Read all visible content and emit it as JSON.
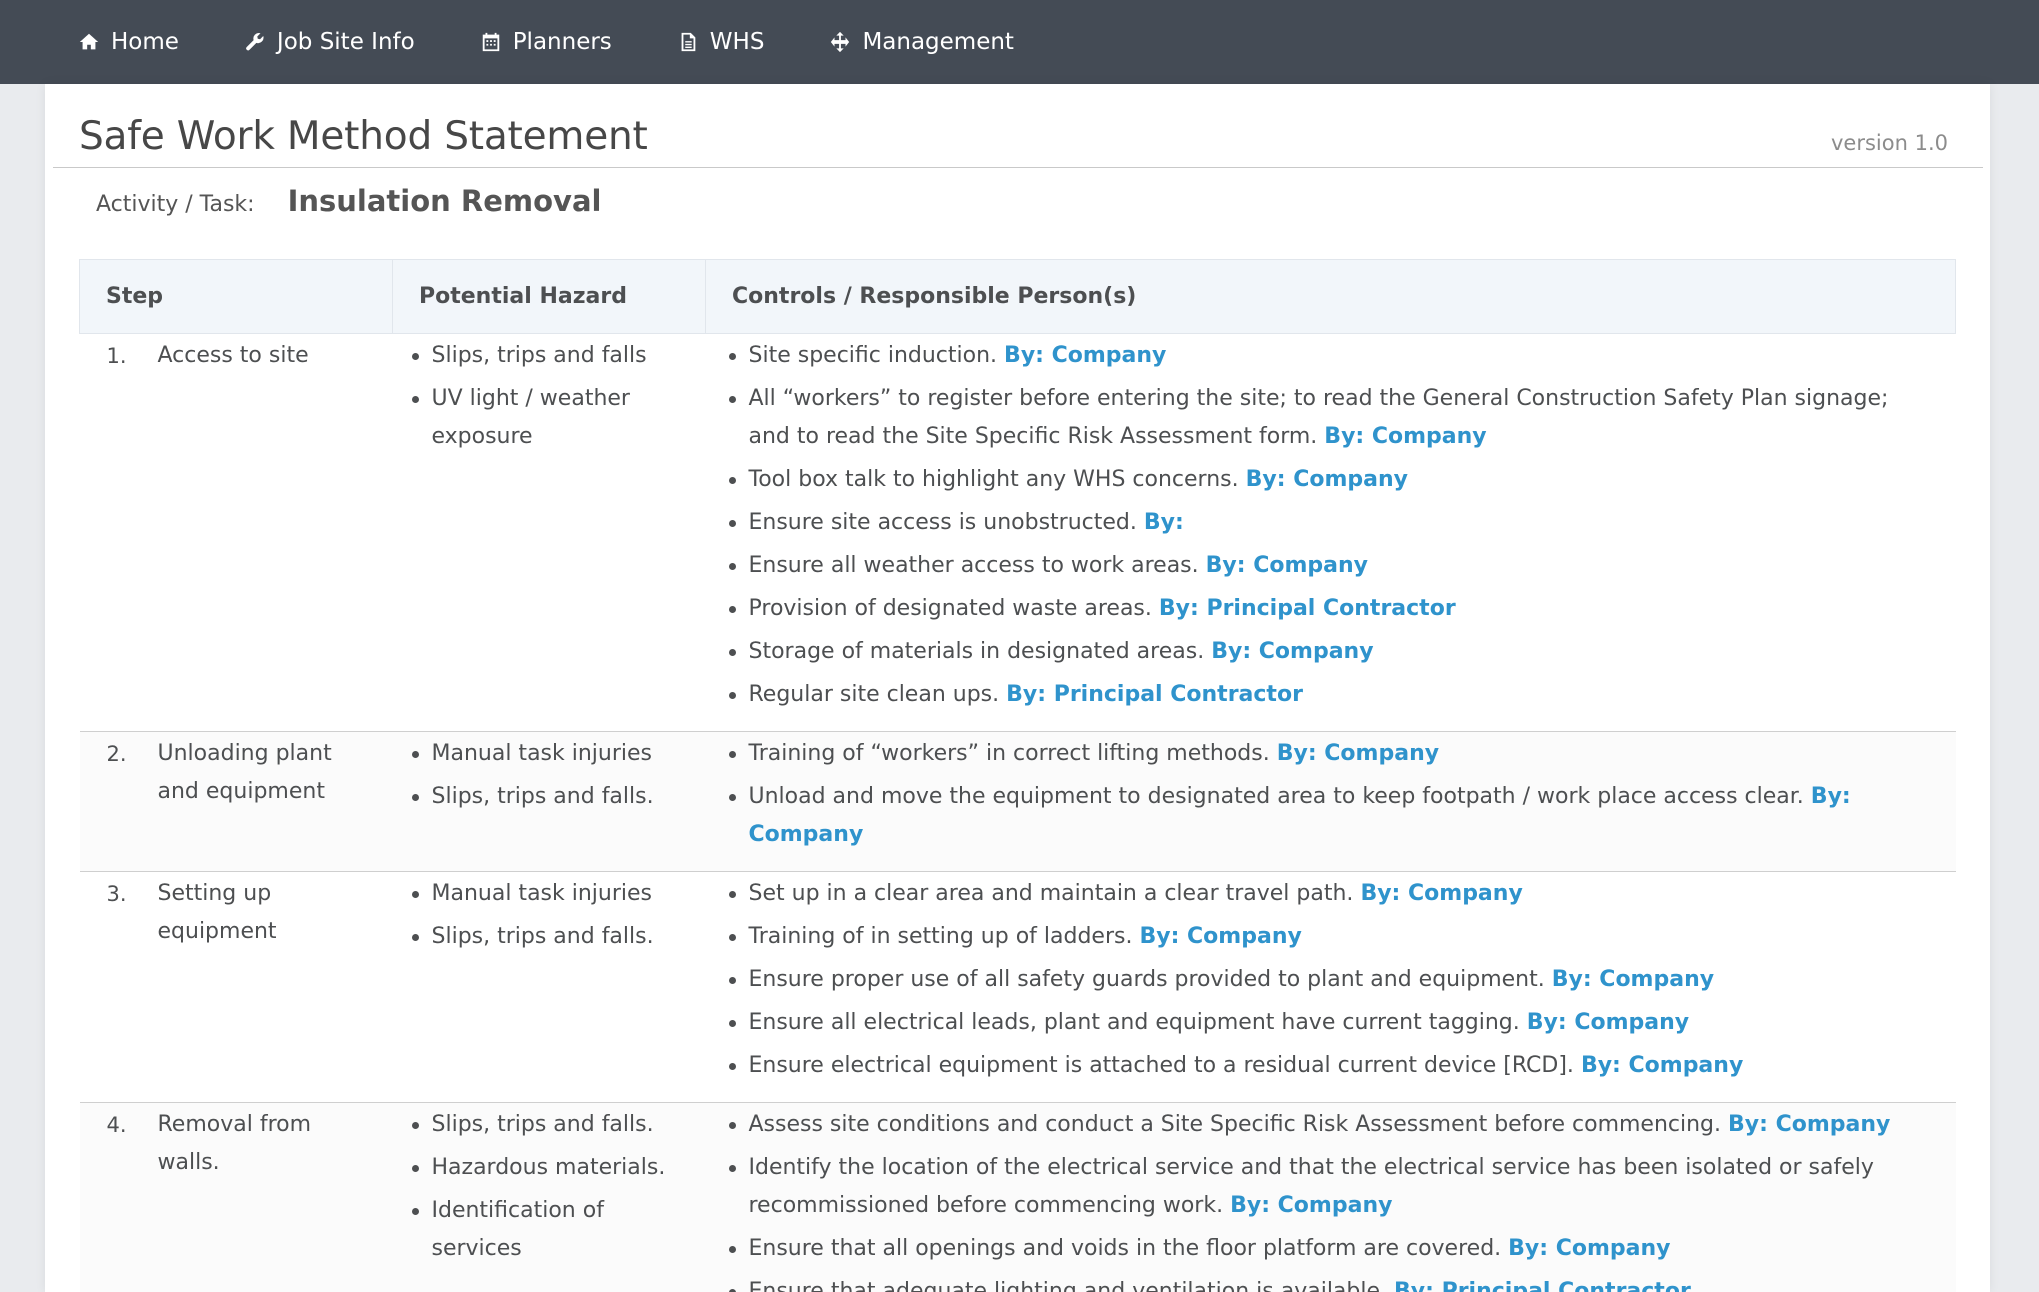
{
  "nav": {
    "items": [
      {
        "label": "Home",
        "icon": "home-icon"
      },
      {
        "label": "Job Site Info",
        "icon": "wrench-icon"
      },
      {
        "label": "Planners",
        "icon": "calendar-icon"
      },
      {
        "label": "WHS",
        "icon": "document-icon"
      },
      {
        "label": "Management",
        "icon": "move-icon"
      }
    ]
  },
  "header": {
    "title": "Safe Work Method Statement",
    "version": "version 1.0",
    "activity_label": "Activity / Task:",
    "activity_value": "Insulation Removal"
  },
  "table": {
    "headers": [
      "Step",
      "Potential Hazard",
      "Controls / Responsible Person(s)"
    ],
    "rows": [
      {
        "num": "1.",
        "step": "Access to site",
        "hazards": [
          "Slips, trips and falls",
          "UV light / weather exposure"
        ],
        "controls": [
          {
            "text": "Site specific induction.",
            "by": "By: Company"
          },
          {
            "text": "All “workers” to register before entering the site; to read the General Construction Safety Plan signage; and to read the Site Specific Risk Assessment form.",
            "by": "By: Company"
          },
          {
            "text": "Tool box talk to highlight any WHS concerns.",
            "by": "By: Company"
          },
          {
            "text": "Ensure site access is unobstructed.",
            "by": "By:"
          },
          {
            "text": "Ensure all weather access to work areas.",
            "by": "By: Company"
          },
          {
            "text": "Provision of designated waste areas.",
            "by": "By: Principal Contractor"
          },
          {
            "text": "Storage of materials in designated areas.",
            "by": "By: Company"
          },
          {
            "text": "Regular site clean ups.",
            "by": "By: Principal Contractor"
          }
        ]
      },
      {
        "num": "2.",
        "step": "Unloading plant and equipment",
        "hazards": [
          "Manual task injuries",
          "Slips, trips and falls."
        ],
        "controls": [
          {
            "text": "Training of “workers” in correct lifting methods.",
            "by": "By: Company"
          },
          {
            "text": "Unload and move the equipment to designated area to keep footpath / work place access clear.",
            "by": "By: Company"
          }
        ]
      },
      {
        "num": "3.",
        "step": "Setting up equipment",
        "hazards": [
          "Manual task injuries",
          "Slips, trips and falls."
        ],
        "controls": [
          {
            "text": "Set up in a clear area and maintain a clear travel path.",
            "by": "By: Company"
          },
          {
            "text": "Training of in setting up of ladders.",
            "by": "By: Company"
          },
          {
            "text": "Ensure proper use of all safety guards provided to plant and equipment.",
            "by": "By: Company"
          },
          {
            "text": "Ensure all electrical leads, plant and equipment have current tagging.",
            "by": "By: Company"
          },
          {
            "text": "Ensure electrical equipment is attached to a residual current device [RCD].",
            "by": "By: Company"
          }
        ]
      },
      {
        "num": "4.",
        "step": "Removal from walls.",
        "hazards": [
          "Slips, trips and falls.",
          "Hazardous materials.",
          "Identification of services"
        ],
        "controls": [
          {
            "text": "Assess site conditions and conduct a Site Specific Risk Assessment before commencing.",
            "by": "By: Company"
          },
          {
            "text": "Identify the location of the electrical service and that the electrical service has been isolated or safely recommissioned before commencing work.",
            "by": "By: Company"
          },
          {
            "text": "Ensure that all openings and voids in the floor platform are covered.",
            "by": "By: Company"
          },
          {
            "text": "Ensure that adequate lighting and ventilation is available.",
            "by": "By: Principal Contractor"
          }
        ]
      }
    ]
  }
}
